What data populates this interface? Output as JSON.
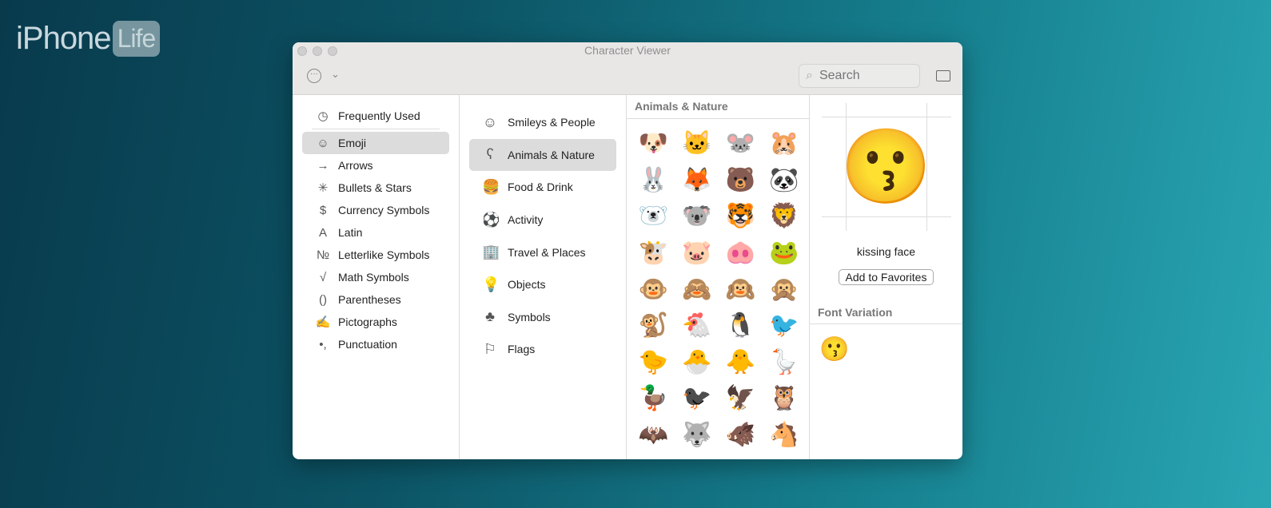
{
  "logo": {
    "text": "iPhone",
    "badge": "Life"
  },
  "window": {
    "title": "Character Viewer",
    "search_placeholder": "Search"
  },
  "categories": [
    {
      "icon": "clock-icon",
      "glyph": "◷",
      "label": "Frequently Used"
    },
    {
      "icon": "smiley-icon",
      "glyph": "☺",
      "label": "Emoji"
    },
    {
      "icon": "arrow-icon",
      "glyph": "→",
      "label": "Arrows"
    },
    {
      "icon": "asterisk-icon",
      "glyph": "✳",
      "label": "Bullets & Stars"
    },
    {
      "icon": "dollar-icon",
      "glyph": "$",
      "label": "Currency Symbols"
    },
    {
      "icon": "latin-a-icon",
      "glyph": "A",
      "label": "Latin"
    },
    {
      "icon": "numero-icon",
      "glyph": "№",
      "label": "Letterlike Symbols"
    },
    {
      "icon": "sqrt-icon",
      "glyph": "√",
      "label": "Math Symbols"
    },
    {
      "icon": "parentheses-icon",
      "glyph": "()",
      "label": "Parentheses"
    },
    {
      "icon": "pictograph-icon",
      "glyph": "✍",
      "label": "Pictographs"
    },
    {
      "icon": "punctuation-icon",
      "glyph": "•,",
      "label": "Punctuation"
    }
  ],
  "subcategories": [
    {
      "icon": "smiley-icon",
      "glyph": "☺",
      "label": "Smileys & People"
    },
    {
      "icon": "bear-icon",
      "glyph": "ʕ",
      "label": "Animals & Nature"
    },
    {
      "icon": "food-icon",
      "glyph": "🍔",
      "label": "Food & Drink"
    },
    {
      "icon": "ball-icon",
      "glyph": "⚽",
      "label": "Activity"
    },
    {
      "icon": "building-icon",
      "glyph": "🏢",
      "label": "Travel & Places"
    },
    {
      "icon": "bulb-icon",
      "glyph": "💡",
      "label": "Objects"
    },
    {
      "icon": "symbols-icon",
      "glyph": "♣",
      "label": "Symbols"
    },
    {
      "icon": "flag-icon",
      "glyph": "⚐",
      "label": "Flags"
    }
  ],
  "section": {
    "title": "Animals & Nature",
    "emojis": [
      "🐶",
      "🐱",
      "🐭",
      "🐹",
      "🐰",
      "🦊",
      "🐻",
      "🐼",
      "🐻‍❄️",
      "🐨",
      "🐯",
      "🦁",
      "🐮",
      "🐷",
      "🐽",
      "🐸",
      "🐵",
      "🙈",
      "🙉",
      "🙊",
      "🐒",
      "🐔",
      "🐧",
      "🐦",
      "🐤",
      "🐣",
      "🐥",
      "🪿",
      "🦆",
      "🐦‍⬛",
      "🦅",
      "🦉",
      "🦇",
      "🐺",
      "🐗",
      "🐴"
    ]
  },
  "detail": {
    "glyph": "😗",
    "name": "kissing face",
    "add_label": "Add to Favorites",
    "variation_title": "Font Variation",
    "variations": [
      "😗"
    ]
  }
}
